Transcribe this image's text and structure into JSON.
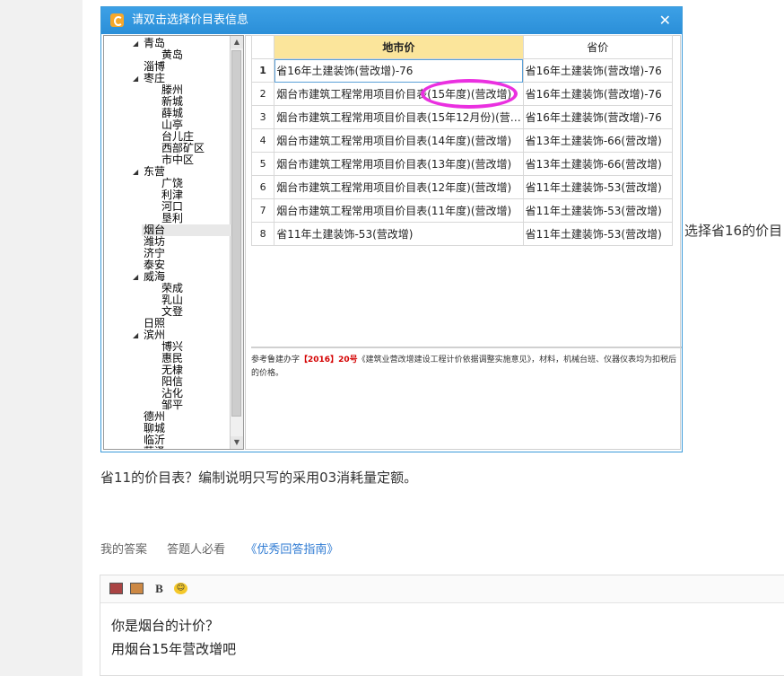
{
  "dialog": {
    "title": "请双击选择价目表信息",
    "close": "✕"
  },
  "tree": [
    {
      "label": "青岛",
      "level": 1,
      "expanded": true
    },
    {
      "label": "黄岛",
      "level": 2
    },
    {
      "label": "淄博",
      "level": 1
    },
    {
      "label": "枣庄",
      "level": 1,
      "expanded": true
    },
    {
      "label": "滕州",
      "level": 2
    },
    {
      "label": "新城",
      "level": 2
    },
    {
      "label": "薛城",
      "level": 2
    },
    {
      "label": "山亭",
      "level": 2
    },
    {
      "label": "台儿庄",
      "level": 2
    },
    {
      "label": "西部矿区",
      "level": 2
    },
    {
      "label": "市中区",
      "level": 2
    },
    {
      "label": "东营",
      "level": 1,
      "expanded": true
    },
    {
      "label": "广饶",
      "level": 2
    },
    {
      "label": "利津",
      "level": 2
    },
    {
      "label": "河口",
      "level": 2
    },
    {
      "label": "垦利",
      "level": 2
    },
    {
      "label": "烟台",
      "level": 1,
      "selected": true
    },
    {
      "label": "潍坊",
      "level": 1
    },
    {
      "label": "济宁",
      "level": 1
    },
    {
      "label": "泰安",
      "level": 1
    },
    {
      "label": "威海",
      "level": 1,
      "expanded": true
    },
    {
      "label": "荣成",
      "level": 2
    },
    {
      "label": "乳山",
      "level": 2
    },
    {
      "label": "文登",
      "level": 2
    },
    {
      "label": "日照",
      "level": 1
    },
    {
      "label": "滨州",
      "level": 1,
      "expanded": true
    },
    {
      "label": "博兴",
      "level": 2
    },
    {
      "label": "惠民",
      "level": 2
    },
    {
      "label": "无棣",
      "level": 2
    },
    {
      "label": "阳信",
      "level": 2
    },
    {
      "label": "沾化",
      "level": 2
    },
    {
      "label": "邹平",
      "level": 2
    },
    {
      "label": "德州",
      "level": 1
    },
    {
      "label": "聊城",
      "level": 1
    },
    {
      "label": "临沂",
      "level": 1
    },
    {
      "label": "菏泽",
      "level": 1
    }
  ],
  "grid": {
    "headers": [
      "",
      "地市价",
      "省价"
    ],
    "rows": [
      {
        "num": "1",
        "local": "省16年土建装饰(营改增)-76",
        "prov": "省16年土建装饰(营改增)-76"
      },
      {
        "num": "2",
        "local": "烟台市建筑工程常用项目价目表(15年度)(营改增)",
        "prov": "省16年土建装饰(营改增)-76"
      },
      {
        "num": "3",
        "local": "烟台市建筑工程常用项目价目表(15年12月份)(营…",
        "prov": "省16年土建装饰(营改增)-76"
      },
      {
        "num": "4",
        "local": "烟台市建筑工程常用项目价目表(14年度)(营改增)",
        "prov": "省13年土建装饰-66(营改增)"
      },
      {
        "num": "5",
        "local": "烟台市建筑工程常用项目价目表(13年度)(营改增)",
        "prov": "省13年土建装饰-66(营改增)"
      },
      {
        "num": "6",
        "local": "烟台市建筑工程常用项目价目表(12年度)(营改增)",
        "prov": "省11年土建装饰-53(营改增)"
      },
      {
        "num": "7",
        "local": "烟台市建筑工程常用项目价目表(11年度)(营改增)",
        "prov": "省11年土建装饰-53(营改增)"
      },
      {
        "num": "8",
        "local": "省11年土建装饰-53(营改增)",
        "prov": "省11年土建装饰-53(营改增)"
      }
    ]
  },
  "note": {
    "prefix": "参考鲁建办字",
    "highlight": "【2016】20号",
    "suffix": "《建筑业营改增建设工程计价依据调整实施意见》，材料，机械台班、仪器仪表均为扣税后的价格。"
  },
  "page": {
    "side_text": "选择省16的价目",
    "body_text": "省11的价目表？编制说明只写的采用03消耗量定额。",
    "nav_my_answer": "我的答案",
    "nav_must_read": "答题人必看",
    "nav_guide": "《优秀回答指南》",
    "editor_bold": "B",
    "editor_line1": "你是烟台的计价？",
    "editor_line2": "用烟台15年营改增吧"
  },
  "colors": {
    "title_bar": "#2b8fd8",
    "highlight_header": "#fbe59b",
    "circle": "#ea30e0",
    "link": "#2f7bd3"
  }
}
